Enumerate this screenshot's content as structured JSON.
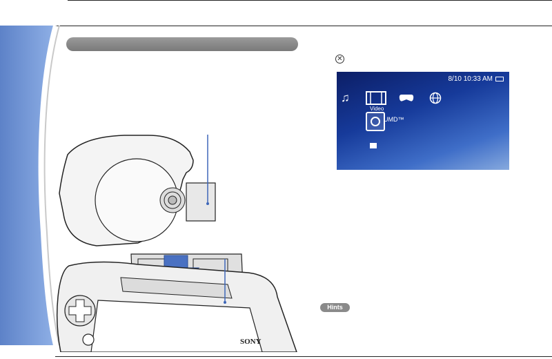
{
  "xmb": {
    "clock": "8/10 10:33 AM",
    "icons": [
      "music-icon",
      "video-icon",
      "game-icon",
      "network-icon"
    ],
    "selected_category": "Video",
    "item_label": "UMD™"
  },
  "circle_button_glyph": "✕",
  "hints_label": "Hints",
  "illustration_brand": "SONY",
  "colors": {
    "sidebar": "#6f92d4",
    "xmb_dark": "#0c1e66",
    "xmb_light": "#86a9de",
    "callout_line": "#3d66b8",
    "section_bar": "#8a8a8a"
  }
}
